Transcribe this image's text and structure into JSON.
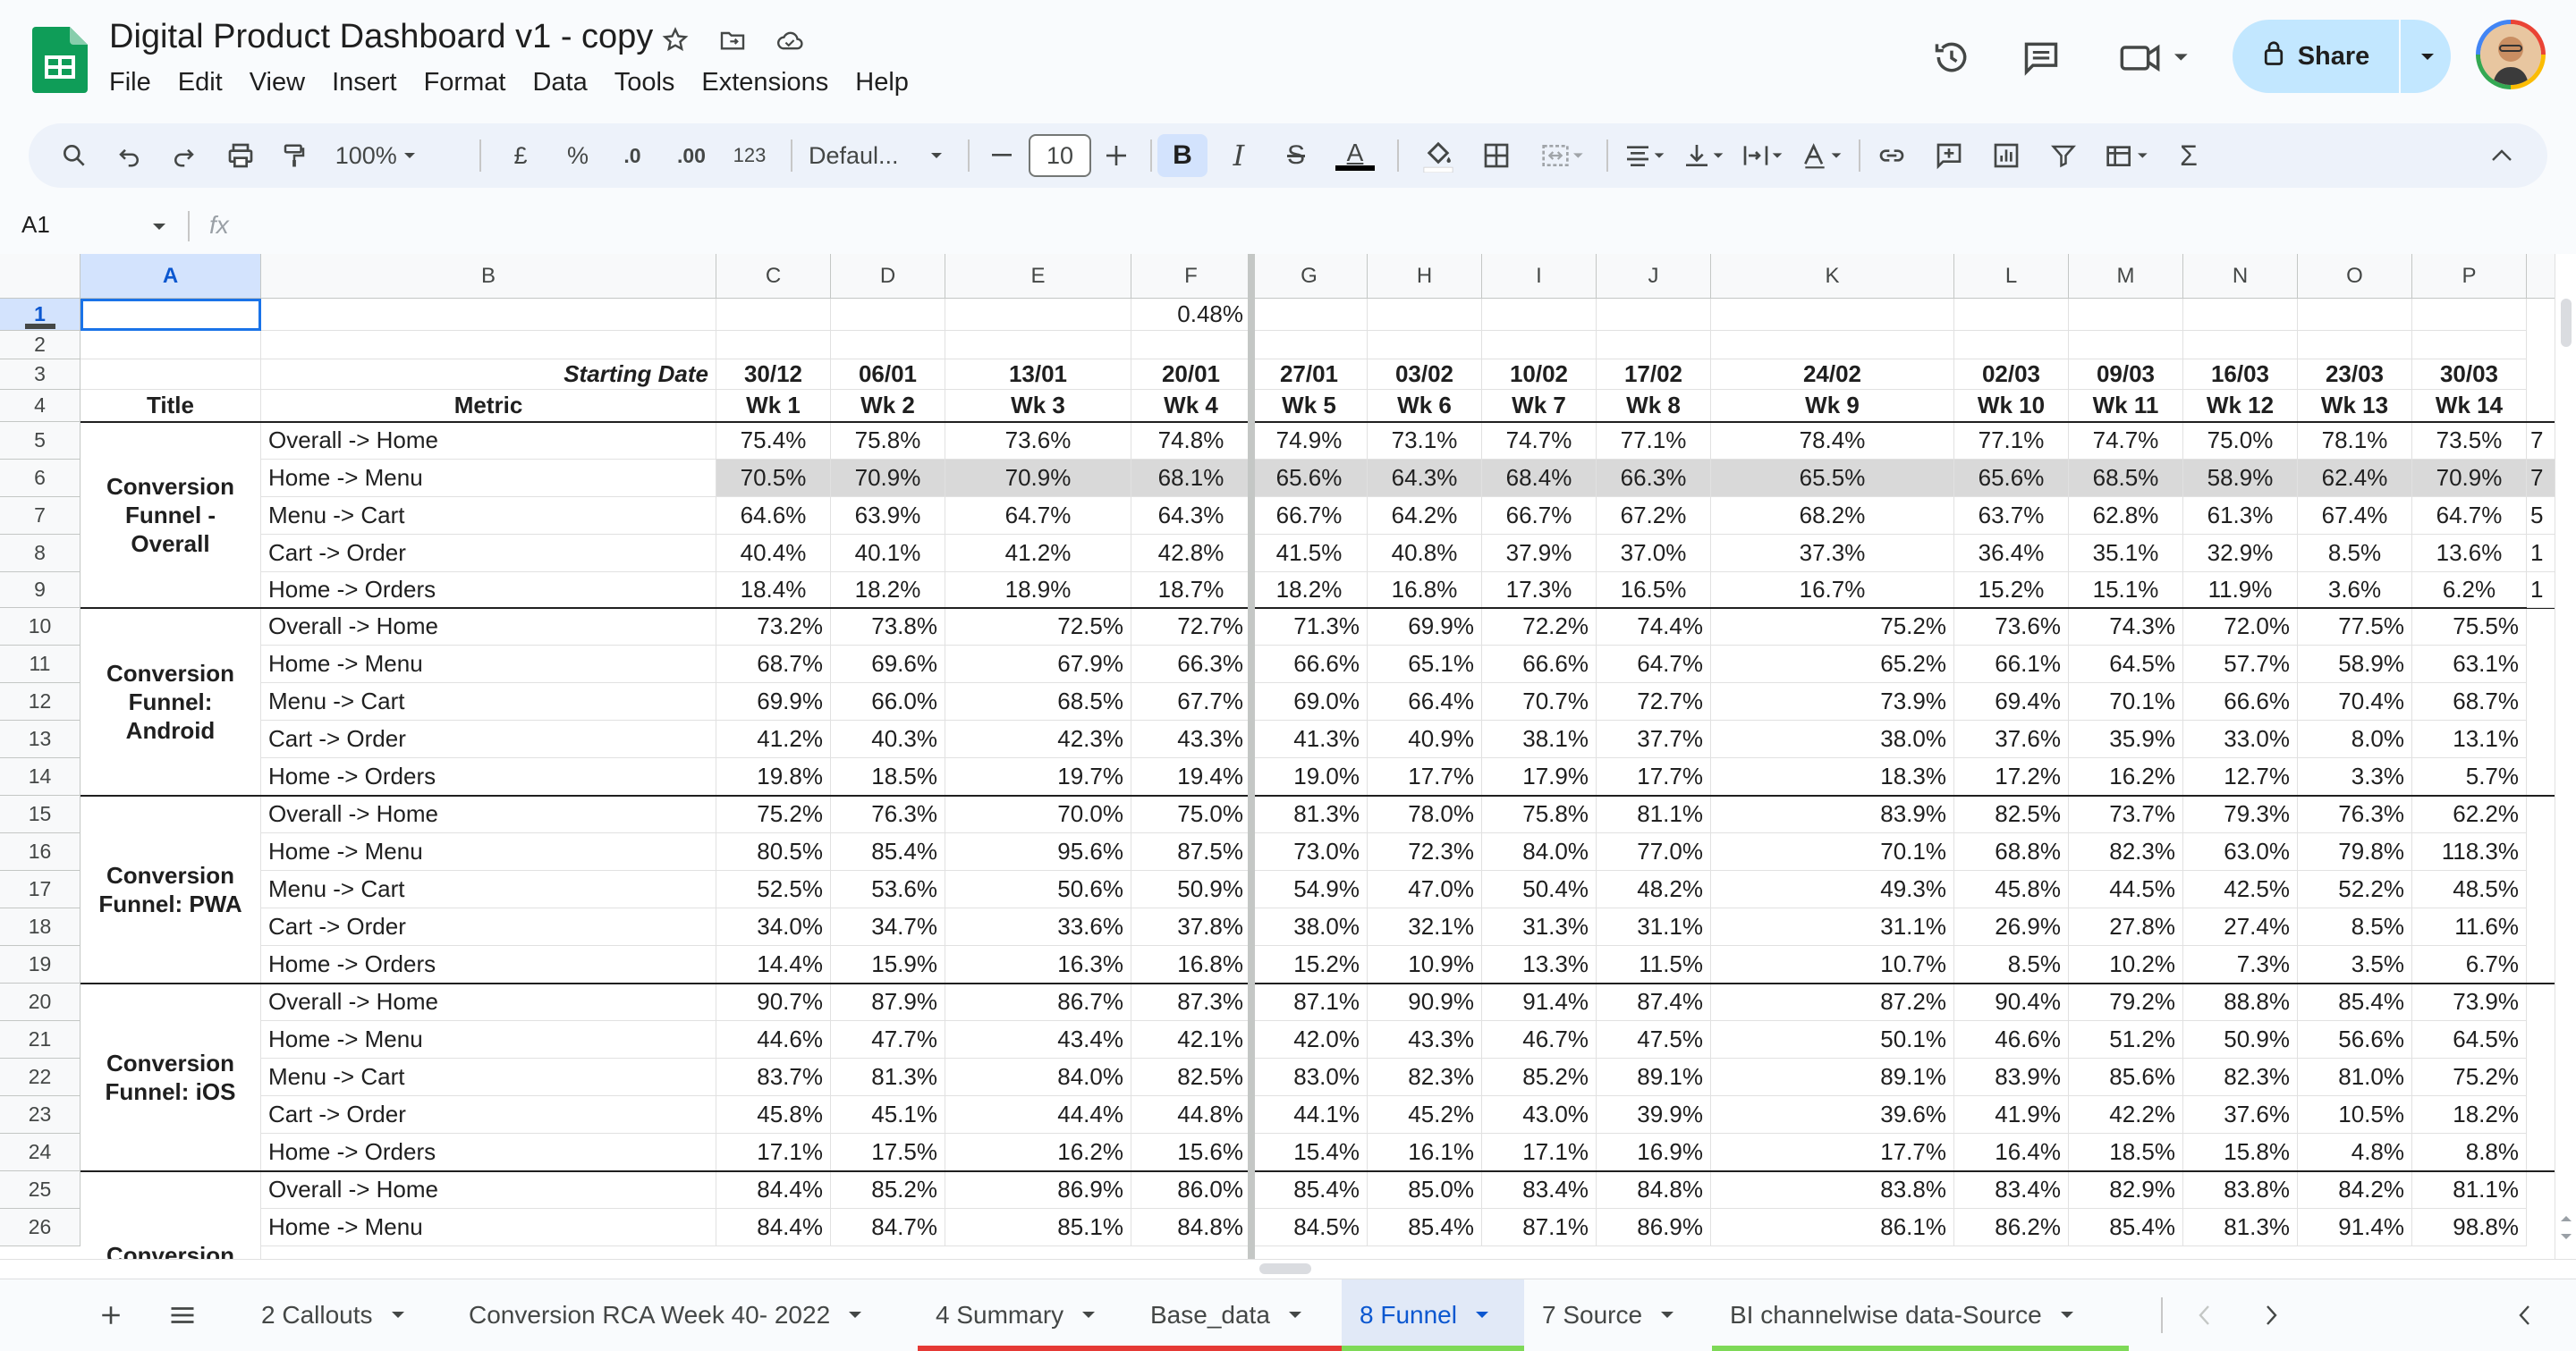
{
  "app": {
    "doc_title": "Digital Product Dashboard v1 - copy",
    "menu": [
      "File",
      "Edit",
      "View",
      "Insert",
      "Format",
      "Data",
      "Tools",
      "Extensions",
      "Help"
    ],
    "share_label": "Share"
  },
  "toolbar": {
    "zoom": "100%",
    "currency": "£",
    "percent": "%",
    "dec_decrease": ".0",
    "dec_increase": ".00",
    "number_format": "123",
    "font": "Defaul...",
    "font_size": "10",
    "bold": "B",
    "italic": "I",
    "strike": "S",
    "text_color": "A",
    "sum": "Σ"
  },
  "formula_bar": {
    "cell_ref": "A1",
    "fx": "fx"
  },
  "columns": [
    "A",
    "B",
    "C",
    "D",
    "E",
    "F",
    "G",
    "H",
    "I",
    "J",
    "K",
    "L",
    "M",
    "N",
    "O",
    "P"
  ],
  "sheet": {
    "f1_value": "0.48%",
    "starting_date_label": "Starting Date",
    "dates": [
      "30/12",
      "06/01",
      "13/01",
      "20/01",
      "27/01",
      "03/02",
      "10/02",
      "17/02",
      "24/02",
      "02/03",
      "09/03",
      "16/03",
      "23/03",
      "30/03"
    ],
    "title_header": "Title",
    "metric_header": "Metric",
    "weeks": [
      "Wk 1",
      "Wk 2",
      "Wk 3",
      "Wk 4",
      "Wk 5",
      "Wk 6",
      "Wk 7",
      "Wk 8",
      "Wk 9",
      "Wk 10",
      "Wk 11",
      "Wk 12",
      "Wk 13",
      "Wk 14"
    ],
    "groups": [
      {
        "title": "Conversion Funnel - Overall",
        "rows": [
          {
            "metric": "Overall -> Home",
            "values": [
              "75.4%",
              "75.8%",
              "73.6%",
              "74.8%",
              "74.9%",
              "73.1%",
              "74.7%",
              "77.1%",
              "78.4%",
              "77.1%",
              "74.7%",
              "75.0%",
              "78.1%",
              "73.5%"
            ]
          },
          {
            "metric": "Home -> Menu",
            "values": [
              "70.5%",
              "70.9%",
              "70.9%",
              "68.1%",
              "65.6%",
              "64.3%",
              "68.4%",
              "66.3%",
              "65.5%",
              "65.6%",
              "68.5%",
              "58.9%",
              "62.4%",
              "70.9%"
            ]
          },
          {
            "metric": "Menu -> Cart",
            "values": [
              "64.6%",
              "63.9%",
              "64.7%",
              "64.3%",
              "66.7%",
              "64.2%",
              "66.7%",
              "67.2%",
              "68.2%",
              "63.7%",
              "62.8%",
              "61.3%",
              "67.4%",
              "64.7%"
            ]
          },
          {
            "metric": "Cart -> Order",
            "values": [
              "40.4%",
              "40.1%",
              "41.2%",
              "42.8%",
              "41.5%",
              "40.8%",
              "37.9%",
              "37.0%",
              "37.3%",
              "36.4%",
              "35.1%",
              "32.9%",
              "8.5%",
              "13.6%"
            ]
          },
          {
            "metric": "Home -> Orders",
            "values": [
              "18.4%",
              "18.2%",
              "18.9%",
              "18.7%",
              "18.2%",
              "16.8%",
              "17.3%",
              "16.5%",
              "16.7%",
              "15.2%",
              "15.1%",
              "11.9%",
              "3.6%",
              "6.2%"
            ]
          }
        ]
      },
      {
        "title": "Conversion Funnel: Android",
        "rows": [
          {
            "metric": "Overall -> Home",
            "values": [
              "73.2%",
              "73.8%",
              "72.5%",
              "72.7%",
              "71.3%",
              "69.9%",
              "72.2%",
              "74.4%",
              "75.2%",
              "73.6%",
              "74.3%",
              "72.0%",
              "77.5%",
              "75.5%"
            ]
          },
          {
            "metric": "Home -> Menu",
            "values": [
              "68.7%",
              "69.6%",
              "67.9%",
              "66.3%",
              "66.6%",
              "65.1%",
              "66.6%",
              "64.7%",
              "65.2%",
              "66.1%",
              "64.5%",
              "57.7%",
              "58.9%",
              "63.1%"
            ]
          },
          {
            "metric": "Menu -> Cart",
            "values": [
              "69.9%",
              "66.0%",
              "68.5%",
              "67.7%",
              "69.0%",
              "66.4%",
              "70.7%",
              "72.7%",
              "73.9%",
              "69.4%",
              "70.1%",
              "66.6%",
              "70.4%",
              "68.7%"
            ]
          },
          {
            "metric": "Cart -> Order",
            "values": [
              "41.2%",
              "40.3%",
              "42.3%",
              "43.3%",
              "41.3%",
              "40.9%",
              "38.1%",
              "37.7%",
              "38.0%",
              "37.6%",
              "35.9%",
              "33.0%",
              "8.0%",
              "13.1%"
            ]
          },
          {
            "metric": "Home -> Orders",
            "values": [
              "19.8%",
              "18.5%",
              "19.7%",
              "19.4%",
              "19.0%",
              "17.7%",
              "17.9%",
              "17.7%",
              "18.3%",
              "17.2%",
              "16.2%",
              "12.7%",
              "3.3%",
              "5.7%"
            ]
          }
        ]
      },
      {
        "title": "Conversion Funnel: PWA",
        "rows": [
          {
            "metric": "Overall -> Home",
            "values": [
              "75.2%",
              "76.3%",
              "70.0%",
              "75.0%",
              "81.3%",
              "78.0%",
              "75.8%",
              "81.1%",
              "83.9%",
              "82.5%",
              "73.7%",
              "79.3%",
              "76.3%",
              "62.2%"
            ]
          },
          {
            "metric": "Home -> Menu",
            "values": [
              "80.5%",
              "85.4%",
              "95.6%",
              "87.5%",
              "73.0%",
              "72.3%",
              "84.0%",
              "77.0%",
              "70.1%",
              "68.8%",
              "82.3%",
              "63.0%",
              "79.8%",
              "118.3%"
            ]
          },
          {
            "metric": "Menu -> Cart",
            "values": [
              "52.5%",
              "53.6%",
              "50.6%",
              "50.9%",
              "54.9%",
              "47.0%",
              "50.4%",
              "48.2%",
              "49.3%",
              "45.8%",
              "44.5%",
              "42.5%",
              "52.2%",
              "48.5%"
            ]
          },
          {
            "metric": "Cart -> Order",
            "values": [
              "34.0%",
              "34.7%",
              "33.6%",
              "37.8%",
              "38.0%",
              "32.1%",
              "31.3%",
              "31.1%",
              "31.1%",
              "26.9%",
              "27.8%",
              "27.4%",
              "8.5%",
              "11.6%"
            ]
          },
          {
            "metric": "Home -> Orders",
            "values": [
              "14.4%",
              "15.9%",
              "16.3%",
              "16.8%",
              "15.2%",
              "10.9%",
              "13.3%",
              "11.5%",
              "10.7%",
              "8.5%",
              "10.2%",
              "7.3%",
              "3.5%",
              "6.7%"
            ]
          }
        ]
      },
      {
        "title": "Conversion Funnel: iOS",
        "rows": [
          {
            "metric": "Overall -> Home",
            "values": [
              "90.7%",
              "87.9%",
              "86.7%",
              "87.3%",
              "87.1%",
              "90.9%",
              "91.4%",
              "87.4%",
              "87.2%",
              "90.4%",
              "79.2%",
              "88.8%",
              "85.4%",
              "73.9%"
            ]
          },
          {
            "metric": "Home -> Menu",
            "values": [
              "44.6%",
              "47.7%",
              "43.4%",
              "42.1%",
              "42.0%",
              "43.3%",
              "46.7%",
              "47.5%",
              "50.1%",
              "46.6%",
              "51.2%",
              "50.9%",
              "56.6%",
              "64.5%"
            ]
          },
          {
            "metric": "Menu -> Cart",
            "values": [
              "83.7%",
              "81.3%",
              "84.0%",
              "82.5%",
              "83.0%",
              "82.3%",
              "85.2%",
              "89.1%",
              "89.1%",
              "83.9%",
              "85.6%",
              "82.3%",
              "81.0%",
              "75.2%"
            ]
          },
          {
            "metric": "Cart -> Order",
            "values": [
              "45.8%",
              "45.1%",
              "44.4%",
              "44.8%",
              "44.1%",
              "45.2%",
              "43.0%",
              "39.9%",
              "39.6%",
              "41.9%",
              "42.2%",
              "37.6%",
              "10.5%",
              "18.2%"
            ]
          },
          {
            "metric": "Home -> Orders",
            "values": [
              "17.1%",
              "17.5%",
              "16.2%",
              "15.6%",
              "15.4%",
              "16.1%",
              "17.1%",
              "16.9%",
              "17.7%",
              "16.4%",
              "18.5%",
              "15.8%",
              "4.8%",
              "8.8%"
            ]
          }
        ]
      },
      {
        "title": "Conversion",
        "rows": [
          {
            "metric": "Overall -> Home",
            "values": [
              "84.4%",
              "85.2%",
              "86.9%",
              "86.0%",
              "85.4%",
              "85.0%",
              "83.4%",
              "84.8%",
              "83.8%",
              "83.4%",
              "82.9%",
              "83.8%",
              "84.2%",
              "81.1%"
            ]
          },
          {
            "metric": "Home -> Menu",
            "values": [
              "84.4%",
              "84.7%",
              "85.1%",
              "84.8%",
              "84.5%",
              "85.4%",
              "87.1%",
              "86.9%",
              "86.1%",
              "86.2%",
              "85.4%",
              "81.3%",
              "91.4%",
              "98.8%"
            ]
          }
        ]
      }
    ],
    "overflow_col_q": [
      "7",
      "7",
      "5",
      "1",
      "1"
    ]
  },
  "tabs": [
    {
      "label": "2 Callouts",
      "color": ""
    },
    {
      "label": "Conversion RCA Week 40- 2022",
      "color": ""
    },
    {
      "label": "4 Summary",
      "color": "#e53935"
    },
    {
      "label": "Base_data",
      "color": "#e53935"
    },
    {
      "label": "8 Funnel",
      "color": "#7ed957",
      "active": true
    },
    {
      "label": "7 Source",
      "color": ""
    },
    {
      "label": "BI channelwise data-Source",
      "color": "#7ed957"
    }
  ],
  "colors": {
    "share_bg": "#c2e7ff",
    "selection": "#1a73e8",
    "active_tab": "#0b57d0"
  }
}
